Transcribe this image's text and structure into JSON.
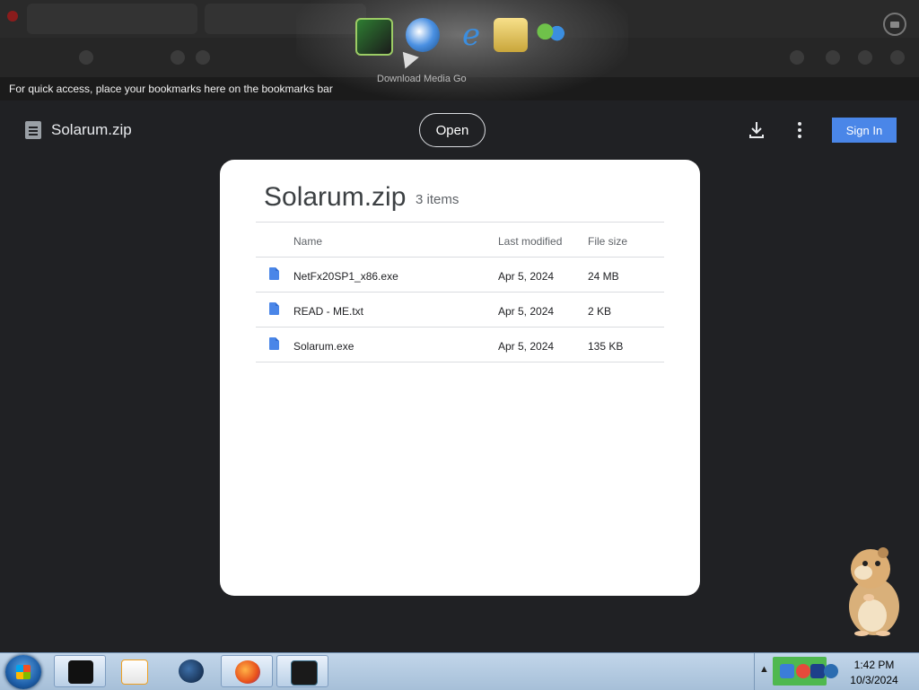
{
  "browser": {
    "bookmarks_hint": "For quick access, place your bookmarks here on the bookmarks bar"
  },
  "dock": {
    "hover_label": "Download Media Go",
    "icons": [
      "media-manager-icon",
      "media-go-download-icon",
      "internet-explorer-icon",
      "folder-icon",
      "messenger-icon"
    ]
  },
  "viewer": {
    "file_title": "Solarum.zip",
    "open_label": "Open",
    "signin_label": "Sign In",
    "accent": "#4a86e8"
  },
  "archive": {
    "title": "Solarum.zip",
    "count": "3 items",
    "columns": {
      "name": "Name",
      "modified": "Last modified",
      "size": "File size"
    },
    "files": [
      {
        "name": "NetFx20SP1_x86.exe",
        "modified": "Apr 5, 2024",
        "size": "24 MB"
      },
      {
        "name": "READ - ME.txt",
        "modified": "Apr 5, 2024",
        "size": "2 KB"
      },
      {
        "name": "Solarum.exe",
        "modified": "Apr 5, 2024",
        "size": "135 KB"
      }
    ]
  },
  "taskbar": {
    "time": "1:42 PM",
    "date": "10/3/2024"
  }
}
